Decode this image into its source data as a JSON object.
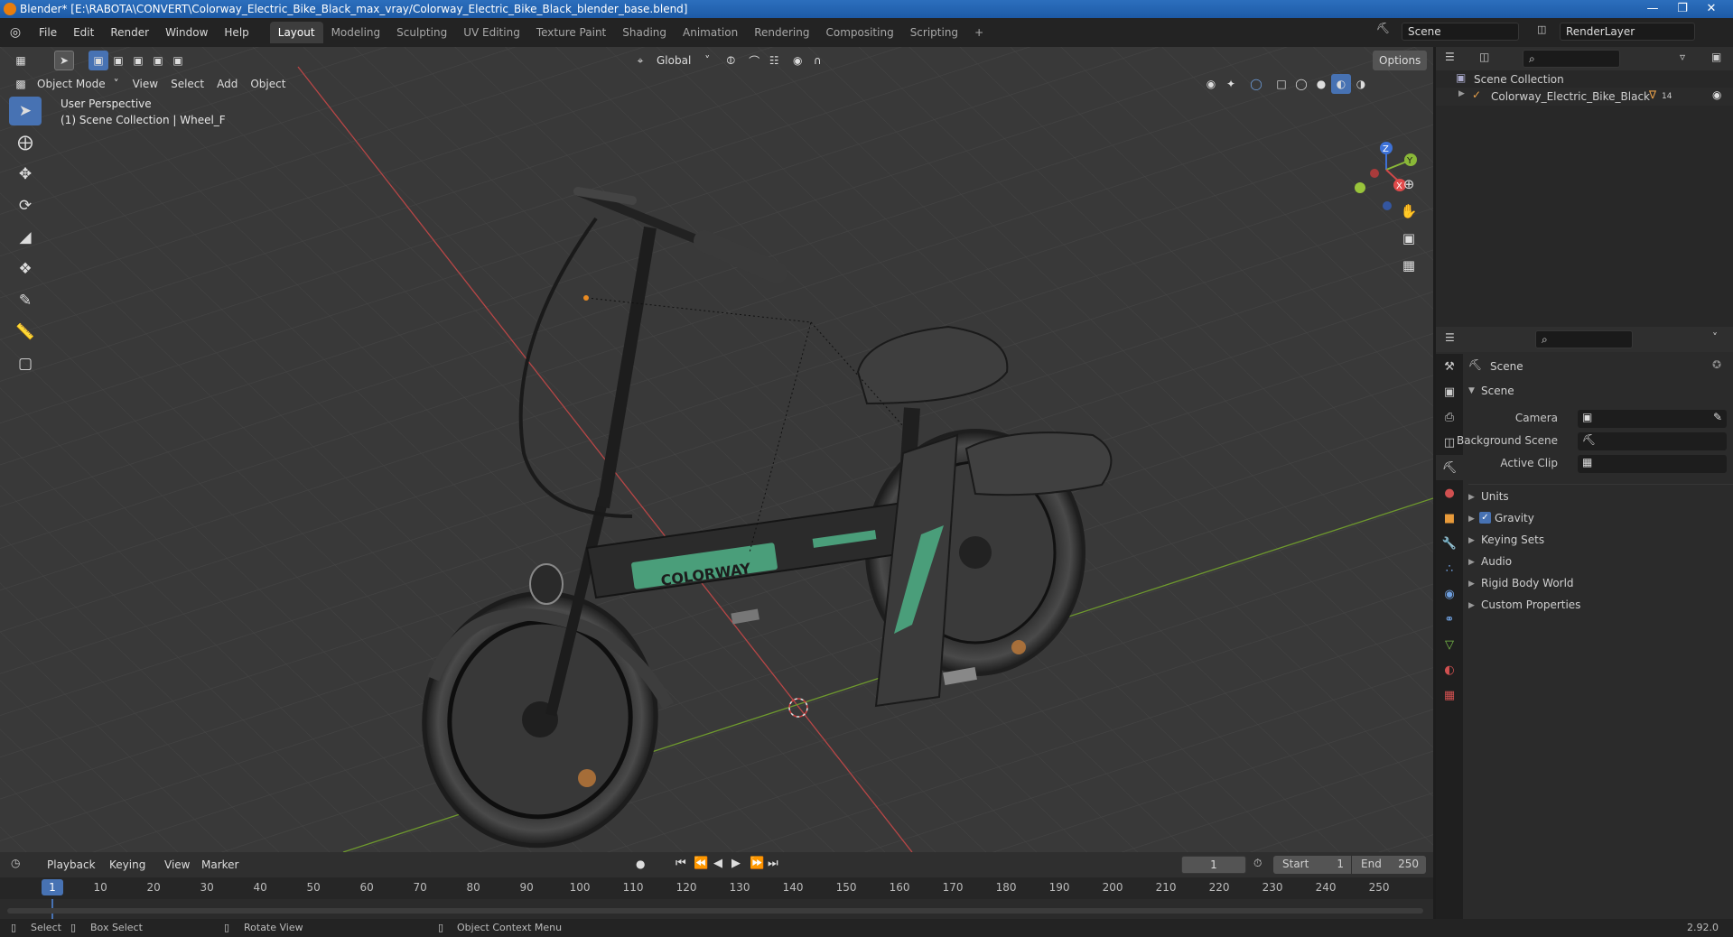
{
  "app": {
    "title": "Blender* [E:\\RABOTA\\CONVERT\\Colorway_Electric_Bike_Black_max_vray/Colorway_Electric_Bike_Black_blender_base.blend]",
    "version": "2.92.0"
  },
  "menu": [
    "File",
    "Edit",
    "Render",
    "Window",
    "Help"
  ],
  "workspaces": [
    "Layout",
    "Modeling",
    "Sculpting",
    "UV Editing",
    "Texture Paint",
    "Shading",
    "Animation",
    "Rendering",
    "Compositing",
    "Scripting"
  ],
  "active_workspace": "Layout",
  "scene_selector": "Scene",
  "render_layer": "RenderLayer",
  "viewport": {
    "transform_orientation": "Global",
    "options_label": "Options",
    "mode": "Object Mode",
    "menus": [
      "View",
      "Select",
      "Add",
      "Object"
    ],
    "perspective_label": "User Perspective",
    "collection_label": "(1) Scene Collection | Wheel_F",
    "gizmo_axes": {
      "x": "X",
      "y": "Y",
      "z": "Z"
    },
    "colors": {
      "x_axis": "#c24a4a",
      "y_axis": "#7aa334",
      "grid": "#444444",
      "background": "#3a3a3a"
    },
    "model_logo_text": "COLORWAY"
  },
  "outliner": {
    "root": "Scene Collection",
    "items": [
      {
        "name": "Colorway_Electric_Bike_Black",
        "badge": "14"
      }
    ]
  },
  "properties": {
    "context": "Scene",
    "panel": "Scene",
    "fields": [
      {
        "label": "Camera"
      },
      {
        "label": "Background Scene"
      },
      {
        "label": "Active Clip"
      }
    ],
    "sections": [
      {
        "label": "Units",
        "checkbox": false
      },
      {
        "label": "Gravity",
        "checkbox": true
      },
      {
        "label": "Keying Sets",
        "checkbox": false
      },
      {
        "label": "Audio",
        "checkbox": false
      },
      {
        "label": "Rigid Body World",
        "checkbox": false
      },
      {
        "label": "Custom Properties",
        "checkbox": false
      }
    ]
  },
  "timeline": {
    "menus": [
      "Playback",
      "Keying",
      "View",
      "Marker"
    ],
    "current_frame": "1",
    "start_label": "Start",
    "start": "1",
    "end_label": "End",
    "end": "250",
    "ticks": [
      "1",
      "10",
      "20",
      "30",
      "40",
      "50",
      "60",
      "70",
      "80",
      "90",
      "100",
      "110",
      "120",
      "130",
      "140",
      "150",
      "160",
      "170",
      "180",
      "190",
      "200",
      "210",
      "220",
      "230",
      "240",
      "250"
    ]
  },
  "statusbar": {
    "select": "Select",
    "box_select": "Box Select",
    "rotate_view": "Rotate View",
    "context_menu": "Object Context Menu"
  }
}
